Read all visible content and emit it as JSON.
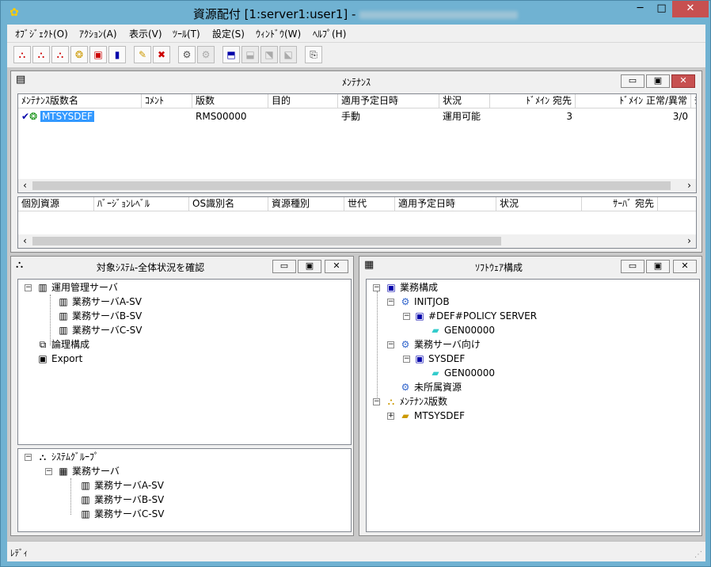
{
  "window": {
    "title_prefix": "資源配付 [1:server1:user1] - ",
    "title_suffix": "",
    "min_glyph": "─",
    "max_glyph": "□",
    "close_glyph": "✕"
  },
  "menu": [
    {
      "label": "ｵﾌﾞｼﾞｪｸﾄ(O)"
    },
    {
      "label": "ｱｸｼｮﾝ(A)"
    },
    {
      "label": "表示(V)"
    },
    {
      "label": "ﾂｰﾙ(T)"
    },
    {
      "label": "設定(S)"
    },
    {
      "label": "ｳｨﾝﾄﾞｳ(W)"
    },
    {
      "label": "ﾍﾙﾌﾟ(H)"
    }
  ],
  "toolbar": {
    "glyphs": [
      "⛬",
      "⛬",
      "⛬",
      "❂",
      "▣",
      "▮",
      "✎",
      "✖",
      "⚙",
      "⚙",
      "⬒",
      "⬓",
      "⬔",
      "⬕",
      "⎘"
    ]
  },
  "maintenance": {
    "title": "ﾒﾝﾃﾅﾝｽ",
    "columns": [
      "ﾒﾝﾃﾅﾝｽ版数名",
      "ｺﾒﾝﾄ",
      "版数",
      "目的",
      "適用予定日時",
      "状況",
      "ﾄﾞﾒｲﾝ 宛先",
      "ﾄﾞﾒｲﾝ 正常/異常",
      "ﾁ"
    ],
    "rows": [
      {
        "name": "MTSYSDEF",
        "comment": "",
        "version": "RMS00000",
        "purpose": "",
        "schedule": "手動",
        "status": "運用可能",
        "domain_dest": "3",
        "domain_ok_ng": "3/0"
      }
    ],
    "detail_columns": [
      "個別資源",
      "ﾊﾞｰｼﾞｮﾝﾚﾍﾞﾙ",
      "OS識別名",
      "資源種別",
      "世代",
      "適用予定日時",
      "状況",
      "ｻｰﾊﾞ 宛先"
    ]
  },
  "target_panel": {
    "title": "対象ｼｽﾃﾑ-全体状況を確認",
    "tree_top": [
      {
        "label": "運用管理サーバ"
      },
      {
        "label": "業務サーバA-SV"
      },
      {
        "label": "業務サーバB-SV"
      },
      {
        "label": "業務サーバC-SV"
      },
      {
        "label": "論理構成"
      },
      {
        "label": "Export"
      }
    ],
    "tree_bottom": [
      {
        "label": "ｼｽﾃﾑｸﾞﾙｰﾌﾟ"
      },
      {
        "label": "業務サーバ"
      },
      {
        "label": "業務サーバA-SV"
      },
      {
        "label": "業務サーバB-SV"
      },
      {
        "label": "業務サーバC-SV"
      }
    ]
  },
  "software_panel": {
    "title": "ｿﾌﾄｳｪｱ構成",
    "tree": [
      {
        "label": "業務構成"
      },
      {
        "label": "INITJOB"
      },
      {
        "label": "#DEF#POLICY SERVER"
      },
      {
        "label": "GEN00000"
      },
      {
        "label": "業務サーバ向け"
      },
      {
        "label": "SYSDEF"
      },
      {
        "label": "GEN00000"
      },
      {
        "label": "未所属資源"
      },
      {
        "label": "ﾒﾝﾃﾅﾝｽ版数"
      },
      {
        "label": "MTSYSDEF"
      }
    ]
  },
  "status": {
    "text": "ﾚﾃﾞｨ"
  }
}
